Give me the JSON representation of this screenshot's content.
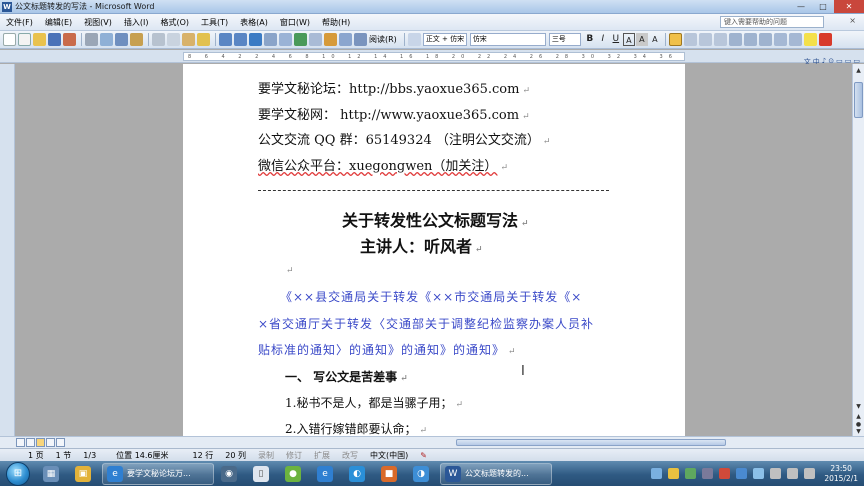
{
  "window": {
    "title": "公文标题转发的写法 - Microsoft Word",
    "app_icon": "W",
    "minimize_label": "—",
    "maximize_label": "□",
    "close_label": "✕"
  },
  "menubar": {
    "items": [
      "文件(F)",
      "编辑(E)",
      "视图(V)",
      "插入(I)",
      "格式(O)",
      "工具(T)",
      "表格(A)",
      "窗口(W)",
      "帮助(H)"
    ],
    "help_search_placeholder": "键入需要帮助的问题",
    "help_close": "×"
  },
  "toolbar": {
    "reading_mode_label": "阅读(R)",
    "style_value": "正文 + 仿宋",
    "font_value": "仿宋",
    "size_value": "三号",
    "bold_label": "B",
    "italic_label": "I",
    "underline_label": "U",
    "char_scale_label": "A"
  },
  "ruler": {
    "numbers": "8 6 4 2 2 4 6 8 10 12 14 16 18 20 22 24 26 28 30 32 34 36 38"
  },
  "langbar": {
    "items": [
      "文",
      "中",
      "♪",
      "⊙",
      "▭",
      "▭",
      "▭"
    ]
  },
  "document": {
    "header_lines": [
      "要学文秘论坛：http://bbs.yaoxue365.com",
      "要学文秘网：   http://www.yaoxue365.com",
      "公文交流 QQ 群：65149324 （注明公文交流）",
      "微信公众平台：xuegongwen（加关注）"
    ],
    "title": "关于转发性公文标题写法",
    "lecturer": "主讲人：听风者",
    "example_lines": [
      "《××县交通局关于转发《××市交通局关于转发《×",
      "×省交通厅关于转发〈交通部关于调整纪检监察办案人员补",
      "贴标准的通知〉的通知》的通知》的通知》"
    ],
    "section_heading": "一、  写公文是苦差事",
    "list_items": [
      "1.秘书不是人，都是当骡子用；",
      "2.入错行嫁错郎要认命；"
    ],
    "para_mark": "↵"
  },
  "statusbar": {
    "page": "1 页",
    "section": "1 节",
    "page_of": "1/3",
    "position": "位置 14.6厘米",
    "line": "12 行",
    "column": "20 列",
    "modes": [
      "录制",
      "修订",
      "扩展",
      "改写"
    ],
    "language": "中文(中国)"
  },
  "taskbar": {
    "start_label": "⊞",
    "apps": [
      {
        "label": "",
        "color": "#6a8fb8",
        "glyph": "▦"
      },
      {
        "label": "",
        "color": "#e2b23a",
        "glyph": "▣"
      },
      {
        "label": "要学文秘论坛万...",
        "color": "#2f7fd1",
        "glyph": "e"
      },
      {
        "label": "",
        "color": "#4a6a8a",
        "glyph": "◉"
      },
      {
        "label": "",
        "color": "#dfe6ef",
        "glyph": "▯"
      },
      {
        "label": "",
        "color": "#6cb33f",
        "glyph": "●"
      },
      {
        "label": "",
        "color": "#2f7fd1",
        "glyph": "e"
      },
      {
        "label": "",
        "color": "#2a8fd8",
        "glyph": "◐"
      },
      {
        "label": "",
        "color": "#d96a2a",
        "glyph": "■"
      },
      {
        "label": "",
        "color": "#3d8ed6",
        "glyph": "◑"
      },
      {
        "label": "公文标题转发的...",
        "color": "#2b5797",
        "glyph": "W"
      }
    ],
    "tray_colors": [
      "#7ab0e0",
      "#e8c040",
      "#5fa85f",
      "#7a7a9a",
      "#d04a3a",
      "#4a8ad0",
      "#8cc0e8",
      "#c0c0c0",
      "#c0c0c0",
      "#c0c0c0"
    ],
    "time": "23:50",
    "date": "2015/2/1"
  }
}
